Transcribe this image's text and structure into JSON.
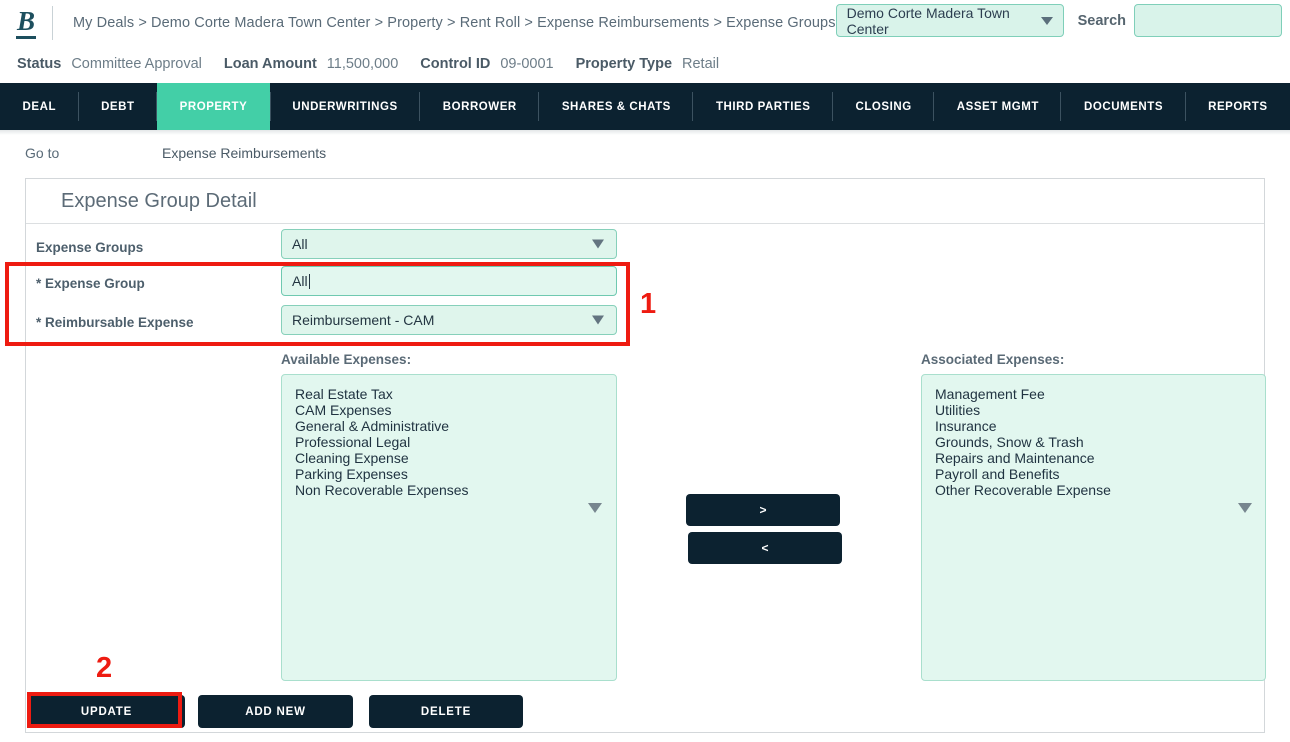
{
  "header": {
    "logo_letter": "B",
    "breadcrumb": "My Deals > Demo Corte Madera Town Center > Property > Rent Roll > Expense Reimbursements > Expense Groups",
    "deal_selector_value": "Demo Corte Madera Town Center",
    "search_label": "Search",
    "search_value": "",
    "search_placeholder": ""
  },
  "status_bar": [
    {
      "key": "Status",
      "value": "Committee Approval"
    },
    {
      "key": "Loan Amount",
      "value": "11,500,000"
    },
    {
      "key": "Control ID",
      "value": "09-0001"
    },
    {
      "key": "Property Type",
      "value": "Retail"
    }
  ],
  "nav": {
    "items": [
      {
        "label": "DEAL",
        "active": false
      },
      {
        "label": "DEBT",
        "active": false
      },
      {
        "label": "PROPERTY",
        "active": true
      },
      {
        "label": "UNDERWRITINGS",
        "active": false
      },
      {
        "label": "BORROWER",
        "active": false
      },
      {
        "label": "SHARES & CHATS",
        "active": false
      },
      {
        "label": "THIRD PARTIES",
        "active": false
      },
      {
        "label": "CLOSING",
        "active": false
      },
      {
        "label": "ASSET MGMT",
        "active": false
      },
      {
        "label": "DOCUMENTS",
        "active": false
      },
      {
        "label": "REPORTS",
        "active": false
      }
    ]
  },
  "goto": {
    "label": "Go to",
    "value": "Expense Reimbursements"
  },
  "panel": {
    "title": "Expense Group Detail",
    "fields": {
      "expense_groups_label": "Expense Groups",
      "expense_groups_value": "All",
      "expense_group_label": "* Expense Group",
      "expense_group_value": "All",
      "reimbursable_expense_label": "* Reimbursable Expense",
      "reimbursable_expense_value": "Reimbursement - CAM"
    },
    "available": {
      "label": "Available Expenses:",
      "items": [
        "Real Estate Tax",
        "CAM Expenses",
        "General & Administrative",
        "Professional Legal",
        "Cleaning Expense",
        "Parking Expenses",
        "Non Recoverable Expenses"
      ]
    },
    "associated": {
      "label": "Associated Expenses:",
      "items": [
        "Management Fee",
        "Utilities",
        "Insurance",
        "Grounds, Snow & Trash",
        "Repairs and Maintenance",
        "Payroll and Benefits",
        "Other Recoverable Expense"
      ]
    },
    "transfer": {
      "add_label": ">",
      "remove_label": "<"
    },
    "buttons": {
      "update": "UPDATE",
      "add_new": "ADD NEW",
      "delete": "DELETE"
    }
  },
  "annotations": {
    "one": "1",
    "two": "2"
  },
  "colors": {
    "nav_bg": "#0c2230",
    "accent_active": "#43cfa7",
    "field_bg": "#dff5ec",
    "field_border": "#86d0ba",
    "annotation_red": "#ee1b11"
  }
}
